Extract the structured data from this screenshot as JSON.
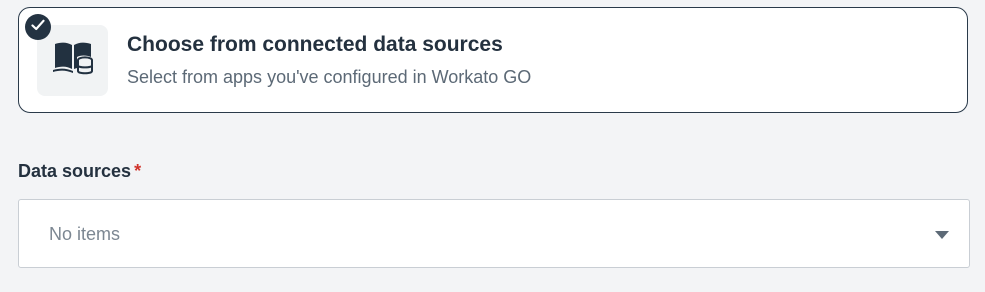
{
  "option_card": {
    "title": "Choose from connected data sources",
    "subtitle": "Select from apps you've configured in Workato GO",
    "selected": true,
    "icon": "book-database-icon",
    "badge_icon": "checkmark-icon"
  },
  "data_sources_field": {
    "label": "Data sources",
    "required_mark": "*",
    "value": "No items",
    "dropdown_icon": "caret-down-icon"
  },
  "colors": {
    "background": "#f3f4f6",
    "card_border": "#2a3a4a",
    "badge": "#243342",
    "required": "#d0332b"
  }
}
